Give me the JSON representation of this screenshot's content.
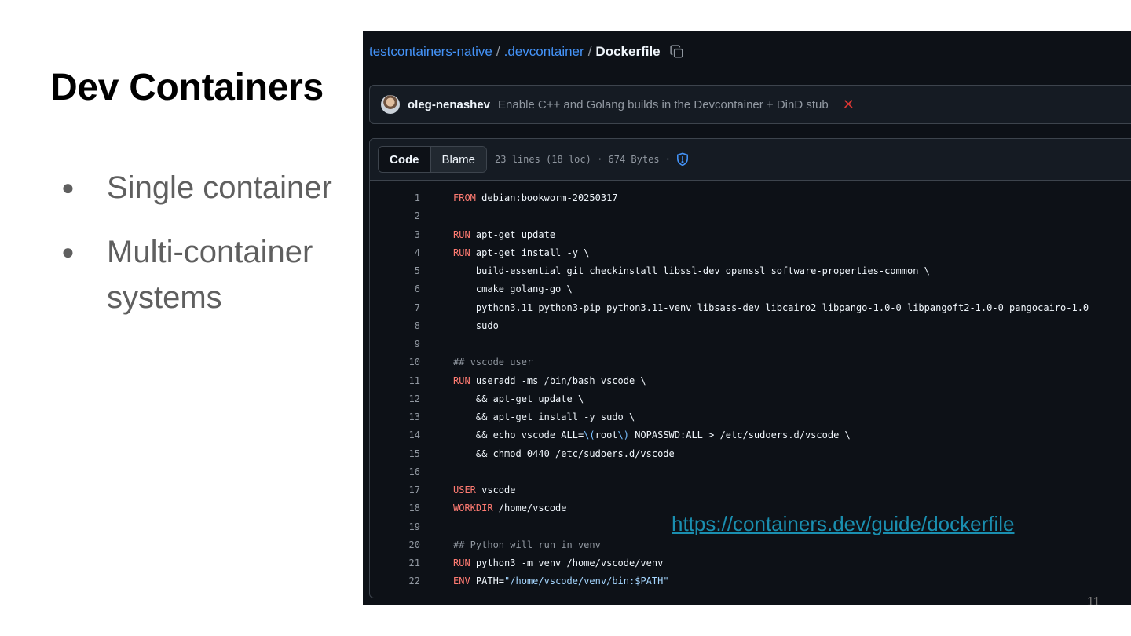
{
  "slide": {
    "title": "Dev Containers",
    "bullets": [
      "Single container",
      "Multi-container systems"
    ],
    "link": "https://containers.dev/guide/dockerfile",
    "page_number": "11"
  },
  "github": {
    "breadcrumb": {
      "repo": "testcontainers-native",
      "folder": ".devcontainer",
      "separator": "/",
      "file": "Dockerfile"
    },
    "commit": {
      "author": "oleg-nenashev",
      "message": "Enable C++ and Golang builds in the Devcontainer + DinD stub",
      "status": "✕"
    },
    "tabs": {
      "code": "Code",
      "blame": "Blame"
    },
    "file_info": "23 lines (18 loc) · 674 Bytes ·",
    "colors": {
      "background": "#0d1117",
      "link": "#4493f8",
      "keyword": "#ff7b72",
      "comment": "#9198a1",
      "string": "#a5d6ff",
      "fail": "#da3633"
    },
    "code_lines": [
      {
        "n": "1",
        "kw": "FROM",
        "text": " debian:bookworm-20250317"
      },
      {
        "n": "2",
        "text": ""
      },
      {
        "n": "3",
        "kw": "RUN",
        "text": " apt-get update"
      },
      {
        "n": "4",
        "kw": "RUN",
        "text": " apt-get install -y \\"
      },
      {
        "n": "5",
        "text": "    build-essential git checkinstall libssl-dev openssl software-properties-common \\"
      },
      {
        "n": "6",
        "text": "    cmake golang-go \\"
      },
      {
        "n": "7",
        "text": "    python3.11 python3-pip python3.11-venv libsass-dev libcairo2 libpango-1.0-0 libpangoft2-1.0-0 pangocairo-1.0"
      },
      {
        "n": "8",
        "text": "    sudo"
      },
      {
        "n": "9",
        "text": ""
      },
      {
        "n": "10",
        "comment": "## vscode user"
      },
      {
        "n": "11",
        "kw": "RUN",
        "text": " useradd -ms /bin/bash vscode \\"
      },
      {
        "n": "12",
        "text": "    && apt-get update \\"
      },
      {
        "n": "13",
        "text": "    && apt-get install -y sudo \\"
      },
      {
        "n": "14",
        "text": "    && echo vscode ALL=\\(root\\) NOPASSWD:ALL > /etc/sudoers.d/vscode \\"
      },
      {
        "n": "15",
        "text": "    && chmod 0440 /etc/sudoers.d/vscode"
      },
      {
        "n": "16",
        "text": ""
      },
      {
        "n": "17",
        "kw": "USER",
        "text": " vscode"
      },
      {
        "n": "18",
        "kw": "WORKDIR",
        "text": " /home/vscode"
      },
      {
        "n": "19",
        "text": ""
      },
      {
        "n": "20",
        "comment": "## Python will run in venv"
      },
      {
        "n": "21",
        "kw": "RUN",
        "text": " python3 -m venv /home/vscode/venv"
      },
      {
        "n": "22",
        "kw": "ENV",
        "text": " PATH=",
        "string": "\"/home/vscode/venv/bin:$PATH\""
      }
    ]
  }
}
